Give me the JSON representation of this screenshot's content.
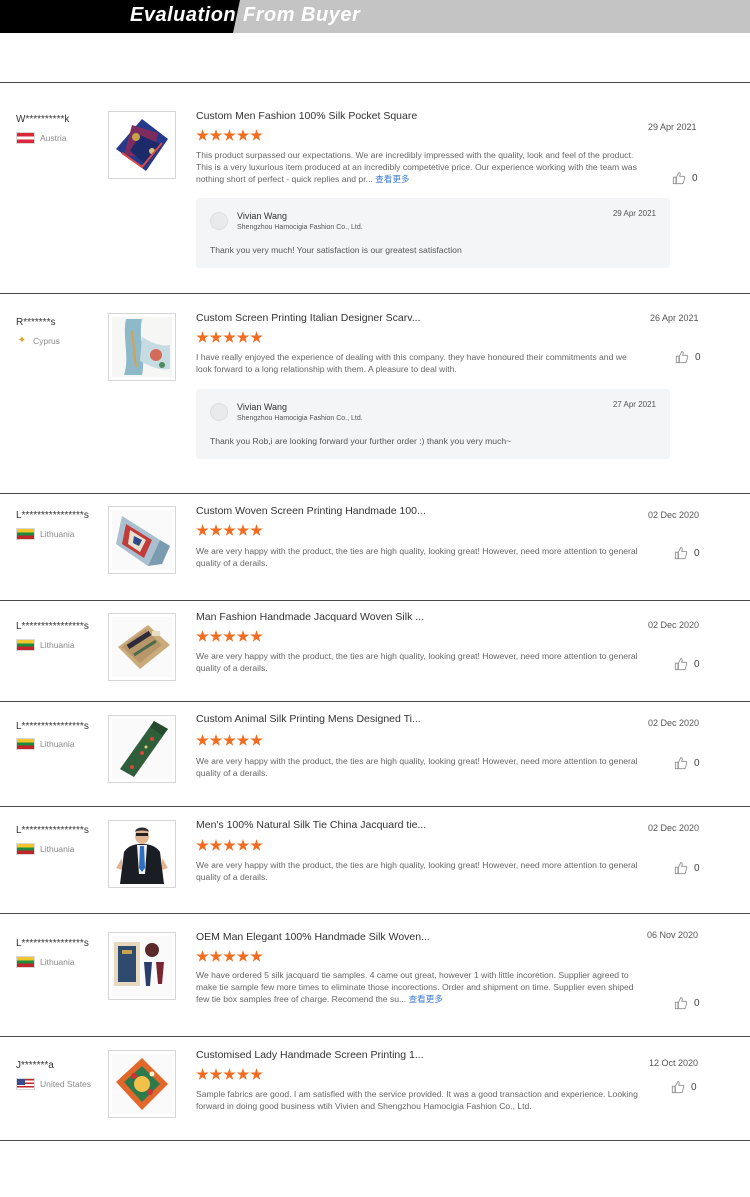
{
  "banner": {
    "part1": "Evaluation",
    "part2": "From Buyer"
  },
  "colors": {
    "accent_star": "#f26d21",
    "link": "#3a7bd5",
    "banner_black": "#000000",
    "banner_gray": "#c4c4c4"
  },
  "icons": {
    "like": "thumbs-up-icon",
    "star": "star-icon"
  },
  "reviews": [
    {
      "user": "W**********k",
      "country": "Austria",
      "flag": "austria",
      "product": "Custom Men Fashion 100% Silk Pocket Square",
      "rating": 5,
      "date": "29 Apr 2021",
      "text": "This product surpassed our expectations. We are incredibly impressed with the quality, look and feel of the product. This is a very luxurious item produced at an incredibly competetive price. Our experience working with the team was nothing short of perfect - quick replies and pr...",
      "more": "查看更多",
      "likes": "0",
      "reply": {
        "name": "Vivian Wang",
        "company": "Shengzhou Hamocigia Fashion Co., Ltd.",
        "date": "29 Apr 2021",
        "text": "Thank you very much! Your satisfaction is our greatest satisfaction"
      }
    },
    {
      "user": "R*******s",
      "country": "Cyprus",
      "flag": "cyprus",
      "product": "Custom Screen Printing Italian Designer Scarv...",
      "rating": 5,
      "date": "26 Apr 2021",
      "text": "I have really enjoyed the experience of dealing with this company. they have honoured their commitments and we look forward to a long relationship with them. A pleasure to deal with.",
      "likes": "0",
      "reply": {
        "name": "Vivian Wang",
        "company": "Shengzhou Hamocigia Fashion Co., Ltd.",
        "date": "27 Apr 2021",
        "text": "Thank you Rob,i are looking forward your further order :) thank you very much~"
      }
    },
    {
      "user": "L****************s",
      "country": "Lithuania",
      "flag": "lithuania",
      "product": "Custom Woven Screen Printing Handmade 100...",
      "rating": 5,
      "date": "02 Dec 2020",
      "text": "We are very happy with the product, the ties are high quality, looking great! However, need more attention to general quality of a derails.",
      "likes": "0"
    },
    {
      "user": "L****************s",
      "country": "Lithuania",
      "flag": "lithuania",
      "product": "Man Fashion Handmade Jacquard Woven Silk ...",
      "rating": 5,
      "date": "02 Dec 2020",
      "text": "We are very happy with the product, the ties are high quality, looking great! However, need more attention to general quality of a derails.",
      "likes": "0"
    },
    {
      "user": "L****************s",
      "country": "Lithuania",
      "flag": "lithuania",
      "product": "Custom Animal Silk Printing Mens Designed Ti...",
      "rating": 5,
      "date": "02 Dec 2020",
      "text": "We are very happy with the product, the ties are high quality, looking great! However, need more attention to general quality of a derails.",
      "likes": "0"
    },
    {
      "user": "L****************s",
      "country": "Lithuania",
      "flag": "lithuania",
      "product": "Men's 100% Natural Silk Tie China Jacquard tie...",
      "rating": 5,
      "date": "02 Dec 2020",
      "text": "We are very happy with the product, the ties are high quality, looking great! However, need more attention to general quality of a derails.",
      "likes": "0"
    },
    {
      "user": "L****************s",
      "country": "Lithuania",
      "flag": "lithuania",
      "product": "OEM Man Elegant 100% Handmade Silk Woven...",
      "rating": 5,
      "date": "06 Nov 2020",
      "text": "We have ordered 5 silk jacquard tie samples. 4 came out great, however 1 with little incoretion. Supplier agreed to make tie sample few more times to eliminate those incorections. Order and shipment on time. Supplier even shiped few tie box samples free of charge. Recomend the su...",
      "more": "查看更多",
      "likes": "0"
    },
    {
      "user": "J*******a",
      "country": "United States",
      "flag": "us",
      "product": "Customised Lady Handmade Screen Printing 1...",
      "rating": 5,
      "date": "12 Oct 2020",
      "text": "Sample fabrics are good. I am satisfied with the service provided. It was a good transaction and experience. Looking forward in doing good business wtih Vivien and Shengzhou Hamocigia Fashion Co., Ltd.",
      "likes": "0"
    }
  ]
}
